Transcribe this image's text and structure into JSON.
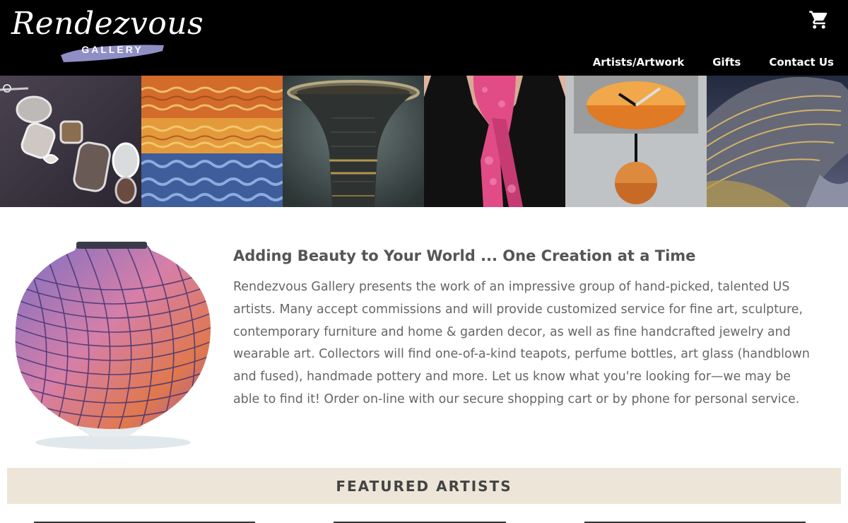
{
  "header": {
    "logo_script": "Rendezvous",
    "logo_sub": "GALLERY",
    "nav": [
      {
        "label": "Artists/Artwork"
      },
      {
        "label": "Gifts"
      },
      {
        "label": "Contact Us"
      }
    ],
    "cart_icon": "shopping-cart-icon"
  },
  "banner": {
    "tiles": [
      "jewelry-bracelet",
      "abstract-reflection-painting",
      "ceramic-vessel",
      "silk-scarf",
      "pendulum-clock",
      "art-glass-bowl"
    ]
  },
  "intro": {
    "headline": "Adding Beauty to Your World ... One Creation at a Time",
    "body": "Rendezvous Gallery presents the work of an impressive group of hand-picked, talented US artists. Many accept commissions and will provide customized service for fine art, sculpture, contemporary furniture and home & garden decor, as well as fine handcrafted jewelry and wearable art. Collectors will find one-of-a-kind teapots, perfume bottles, art glass (handblown and fused), handmade pottery and more. Let us know what you're looking for—we may be able to find it! Order on-line with our secure shopping cart or by phone for personal service."
  },
  "featured": {
    "title": "FEATURED ARTISTS"
  },
  "colors": {
    "header_bg": "#000000",
    "featured_bg": "#ede6d8",
    "text": "#555555"
  }
}
